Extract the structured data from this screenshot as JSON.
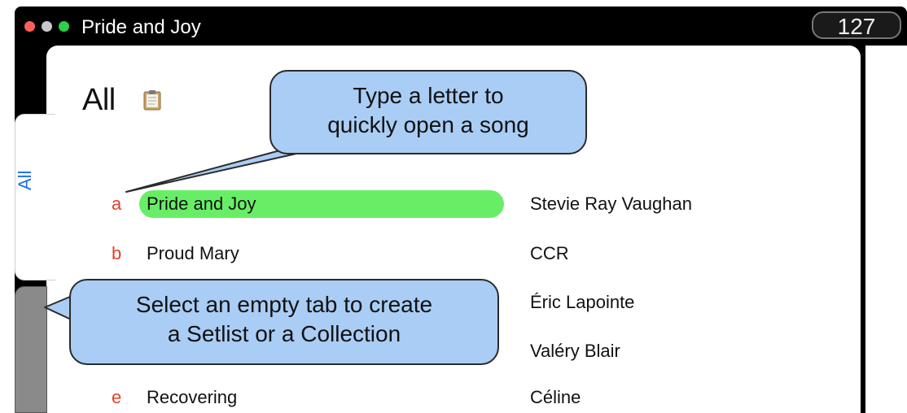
{
  "window": {
    "title": "Pride and Joy",
    "counter": "127",
    "traffic_lights": [
      "red",
      "gray",
      "green"
    ]
  },
  "header": {
    "title": "All",
    "icon": "clipboard-icon"
  },
  "tabs": [
    {
      "label": "All",
      "selected": true
    },
    {
      "label": "",
      "selected": false
    }
  ],
  "songs": [
    {
      "letter": "a",
      "title": "Pride and Joy",
      "artist": "Stevie Ray Vaughan",
      "highlighted": true
    },
    {
      "letter": "b",
      "title": "Proud Mary",
      "artist": "CCR",
      "highlighted": false
    },
    {
      "letter": "",
      "title": "",
      "artist": "Éric Lapointe",
      "highlighted": false
    },
    {
      "letter": "",
      "title": "",
      "artist": "Valéry Blair",
      "highlighted": false
    },
    {
      "letter": "e",
      "title": "Recovering",
      "artist": "Céline",
      "highlighted": false
    }
  ],
  "callouts": {
    "letter_hint": {
      "line1": "Type a letter to",
      "line2": "quickly open a song"
    },
    "tab_hint": {
      "line1": "Select an empty tab to create",
      "line2": "a Setlist or a Collection"
    }
  },
  "colors": {
    "highlight": "#68ee66",
    "letter": "#e8402a",
    "tab_label": "#1e6fe6",
    "callout": "#a9cdf5"
  }
}
